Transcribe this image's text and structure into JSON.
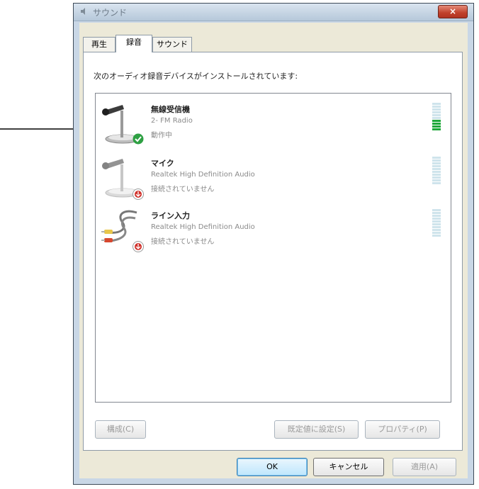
{
  "window": {
    "title": "サウンド",
    "close_label": "×"
  },
  "tabs": [
    {
      "label": "再生",
      "active": false
    },
    {
      "label": "録音",
      "active": true
    },
    {
      "label": "サウンド",
      "active": false
    }
  ],
  "instruction": "次のオーディオ録音デバイスがインストールされています:",
  "devices": [
    {
      "name": "無線受信機",
      "description": "2- FM Radio",
      "status": "動作中",
      "status_icon": "green-check-icon",
      "level": 0.35
    },
    {
      "name": "マイク",
      "description": "Realtek High Definition Audio",
      "status": "接続されていません",
      "status_icon": "red-down-arrow-icon",
      "level": 0
    },
    {
      "name": "ライン入力",
      "description": "Realtek High Definition Audio",
      "status": "接続されていません",
      "status_icon": "red-down-arrow-icon",
      "level": 0
    }
  ],
  "buttons": {
    "configure": "構成(C)",
    "set_default": "既定値に設定(S)",
    "properties": "プロパティ(P)",
    "ok": "OK",
    "cancel": "キャンセル",
    "apply": "適用(A)"
  },
  "colors": {
    "meter_active": "#1fa83a",
    "meter_inactive": "#cfe4ec",
    "status_ok": "#2ea043",
    "status_error": "#d0302a"
  }
}
